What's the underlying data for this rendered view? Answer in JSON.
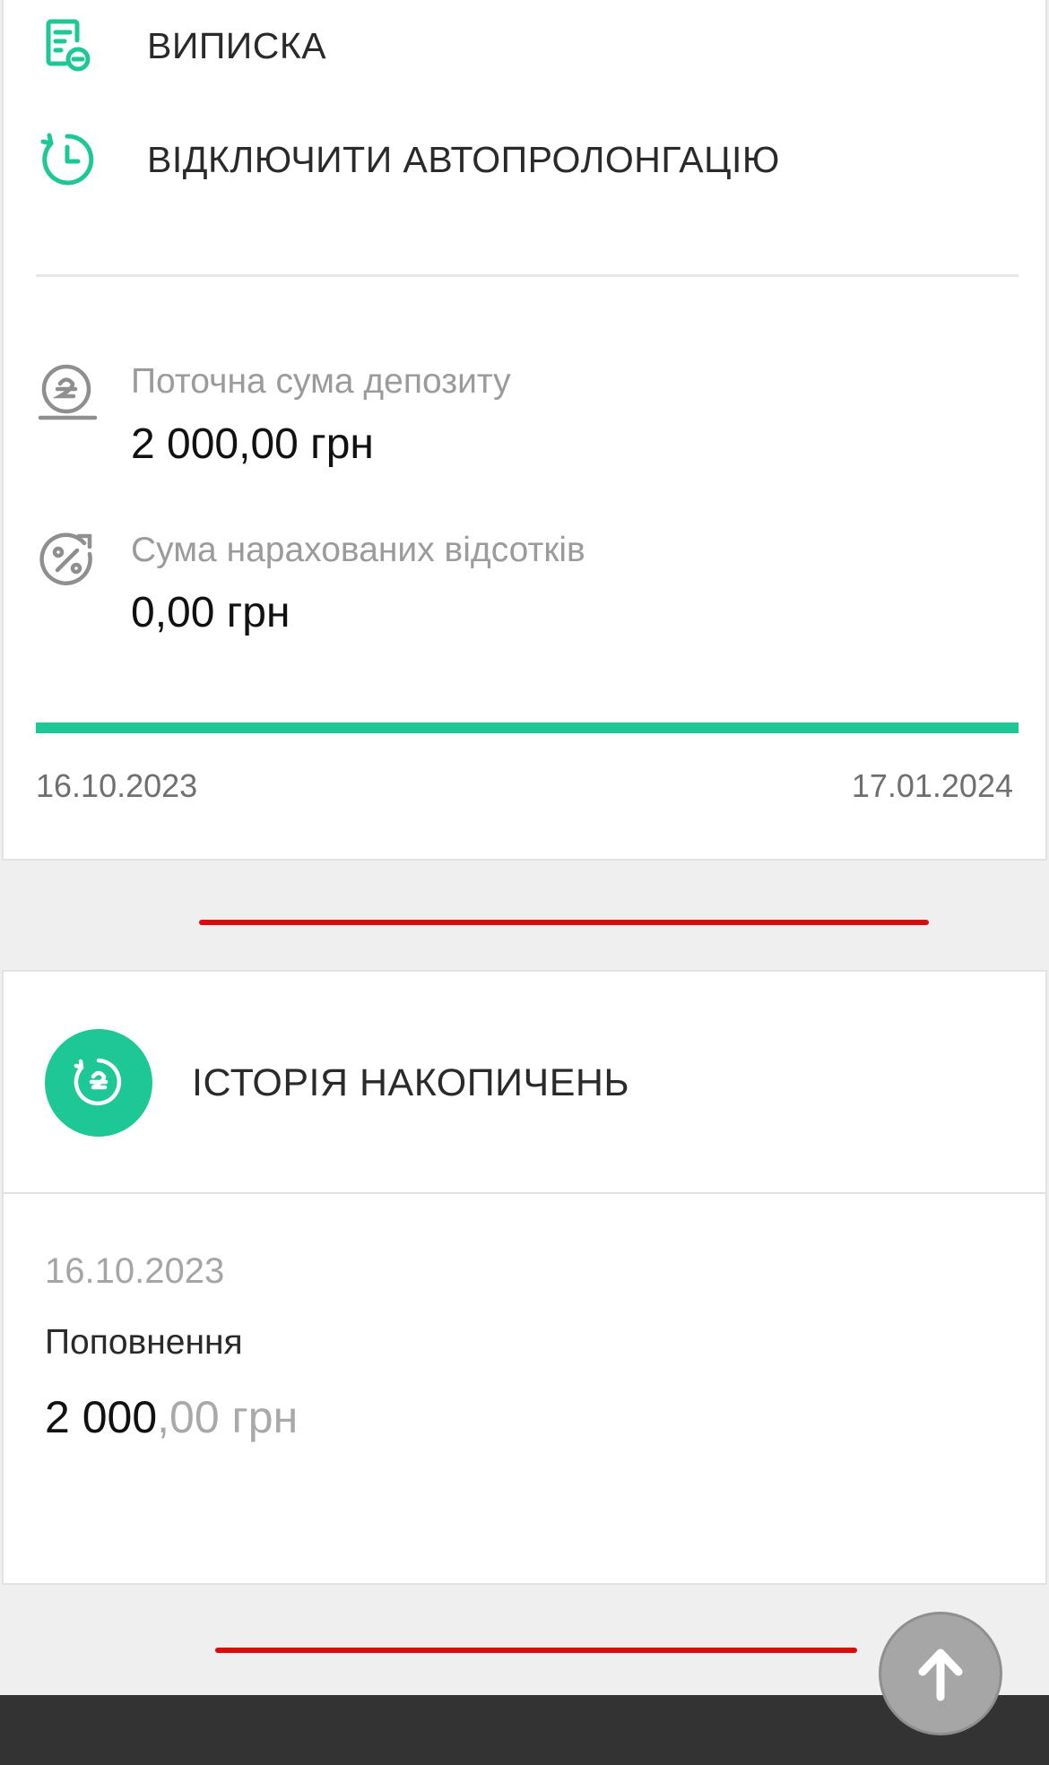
{
  "actions": {
    "statement": {
      "label": "ВИПИСКА",
      "icon": "document-minus-icon"
    },
    "autorenew": {
      "label": "ВІДКЛЮЧИТИ АВТОПРОЛОНГАЦІЮ",
      "icon": "clock-refresh-icon"
    }
  },
  "deposit": {
    "current_amount": {
      "caption": "Поточна сума депозиту",
      "value": "2 000,00 грн",
      "icon": "hryvnia-coin-icon"
    },
    "interest": {
      "caption": "Сума нарахованих відсотків",
      "value": "0,00 грн",
      "icon": "percent-badge-icon"
    },
    "term": {
      "start_date": "16.10.2023",
      "end_date": "17.01.2024",
      "progress": 1.0
    }
  },
  "history": {
    "title": "ІСТОРІЯ НАКОПИЧЕНЬ",
    "icon": "hryvnia-history-icon",
    "transactions": [
      {
        "date": "16.10.2023",
        "type": "Поповнення",
        "amount_int": "2 000",
        "amount_dec": ",00 грн"
      }
    ]
  },
  "scroll_top": {
    "icon": "arrow-up-icon"
  },
  "colors": {
    "accent": "#1ec896",
    "alert": "#dd0a0a",
    "muted": "#9b9b9b",
    "bottom_bar": "#333333"
  }
}
